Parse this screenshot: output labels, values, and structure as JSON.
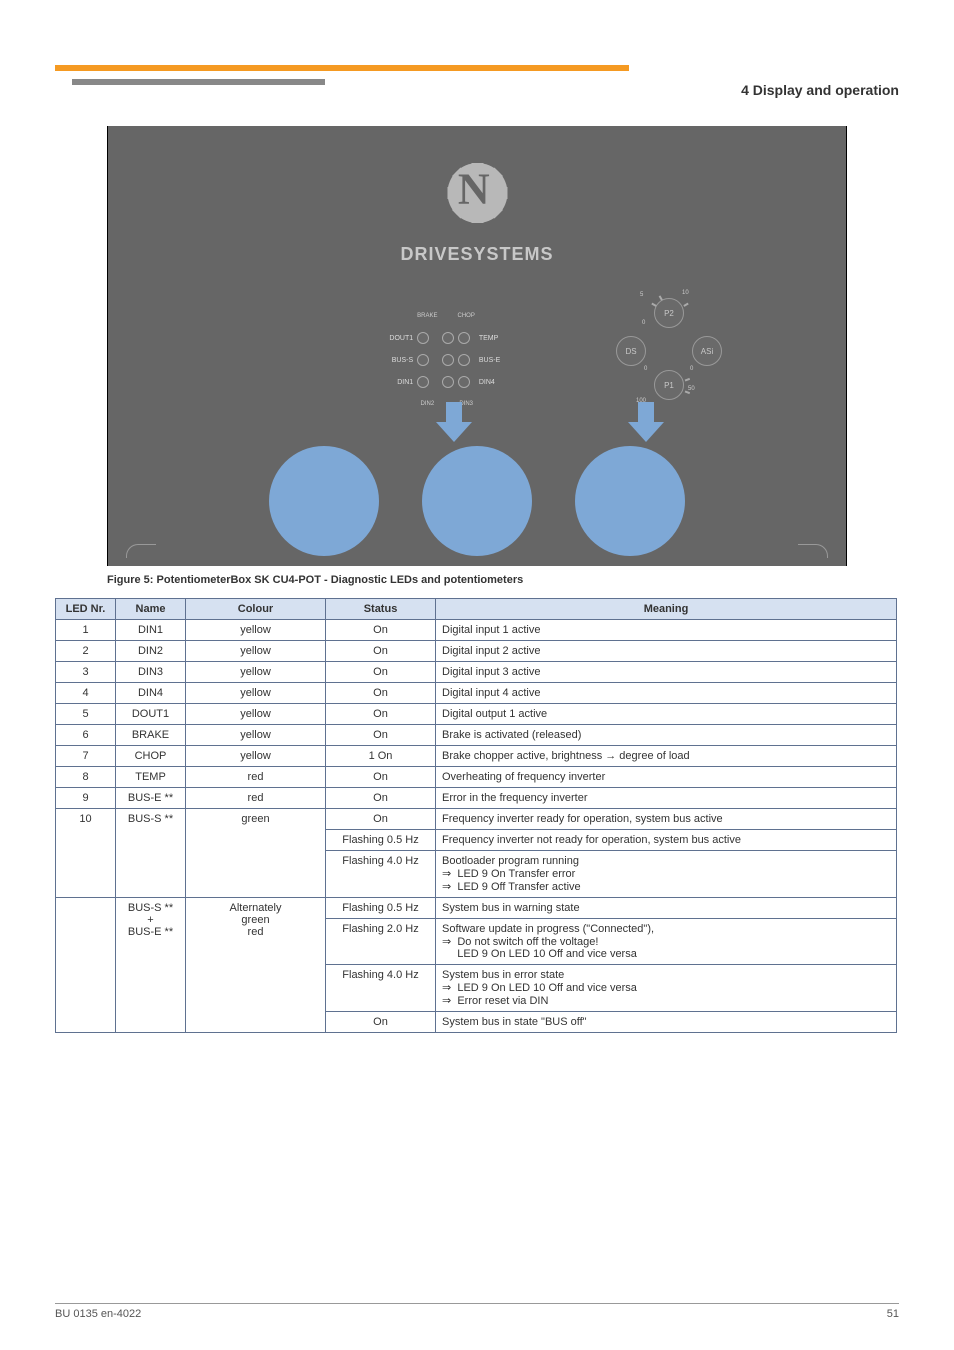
{
  "breadcrumb": "4 Display and operation",
  "figure": {
    "brand": "DRIVESYSTEMS",
    "gear_letter": "N",
    "left_labels": {
      "brake": "BRAKE",
      "chop": "CHOP",
      "dout1": "DOUT1",
      "temp": "TEMP",
      "bus_s": "BUS-S",
      "bus_e": "BUS-E",
      "din1": "DIN1",
      "din4": "DIN4",
      "din2": "DIN2",
      "din3": "DIN3"
    },
    "right_labels": {
      "p2": "P2",
      "p1": "P1",
      "ds": "DS",
      "asi": "ASi",
      "p2_s5": "5",
      "p2_s10": "10",
      "p2_s0_L": "0",
      "p2_s0_R": "0",
      "p1_s100": "100",
      "p1_s50": "50",
      "p1_s0": "0"
    },
    "caption_prefix": "Figure 5: ",
    "caption": "PotentiometerBox SK CU4-POT - Diagnostic LEDs and potentiometers"
  },
  "table": {
    "headers": {
      "lednr": "LED Nr.",
      "name": "Name",
      "colour": "Colour",
      "status": "Status",
      "meaning": "Meaning"
    },
    "rows": [
      {
        "nr": "1",
        "name": "DIN1",
        "col": "yellow",
        "stat": "On",
        "mean": "Digital input 1 active"
      },
      {
        "nr": "2",
        "name": "DIN2",
        "col": "yellow",
        "stat": "On",
        "mean": "Digital input 2 active"
      },
      {
        "nr": "3",
        "name": "DIN3",
        "col": "yellow",
        "stat": "On",
        "mean": "Digital input 3 active"
      },
      {
        "nr": "4",
        "name": "DIN4",
        "col": "yellow",
        "stat": "On",
        "mean": "Digital input 4 active"
      },
      {
        "nr": "5",
        "name": "DOUT1",
        "col": "yellow",
        "stat": "On",
        "mean": "Digital output 1 active"
      },
      {
        "nr": "6",
        "name": "BRAKE",
        "col": "yellow",
        "stat": "On",
        "mean": "Brake is activated (released)"
      },
      {
        "nr": "7",
        "name": "CHOP",
        "col": "yellow",
        "stat": "1 On",
        "mean": "Brake chopper active, brightness → degree of load"
      },
      {
        "nr": "8",
        "name": "TEMP",
        "col": "red",
        "stat": "On",
        "mean": "Overheating of frequency inverter"
      },
      {
        "nr": "9",
        "name": "BUS-E **",
        "col": "red",
        "stat": "On",
        "mean": "Error in the frequency inverter"
      },
      {
        "nr": "10",
        "name": "BUS-S **",
        "col": "green",
        "rowspan": 3,
        "rows": [
          {
            "stat": "On",
            "mean": "Frequency inverter ready for operation, system bus active"
          },
          {
            "stat": "Flashing 0.5 Hz",
            "mean": "Frequency inverter not ready for operation, system bus active"
          },
          {
            "stat": "Flashing 4.0 Hz",
            "mean_lines": [
              "Bootloader program running",
              "LED 9 On                    Transfer error",
              "LED 9 Off                   Transfer active"
            ]
          }
        ]
      },
      {
        "nr": "",
        "name": "BUS-S **\n+\nBUS-E **",
        "status_group": "Alternately",
        "col1": "green",
        "col2": "red",
        "cells": [
          {
            "stat": "Flashing 0.5 Hz",
            "mean": "System bus in warning state"
          },
          {
            "stat": "Flashing 2.0 Hz",
            "mean_lines": [
              "Software update in progress (\"Connected\"),",
              "Do not switch off the voltage!",
              "LED 9 On         LED 10 Off and vice versa"
            ]
          },
          {
            "stat": "Flashing 4.0 Hz",
            "mean_lines": [
              "System bus in error state",
              "LED 9 On          LED 10 Off and vice versa",
              "Error reset via DIN"
            ]
          }
        ]
      },
      {
        "nr": "",
        "name": "",
        "col_span_merge": true,
        "stat": "On",
        "mean": "System bus in state \"BUS off\""
      }
    ]
  },
  "footer": {
    "left": "BU 0135 en-4022",
    "right": "51"
  },
  "sym": {
    "double_arrow": "⇒",
    "right_arrow": "→"
  }
}
